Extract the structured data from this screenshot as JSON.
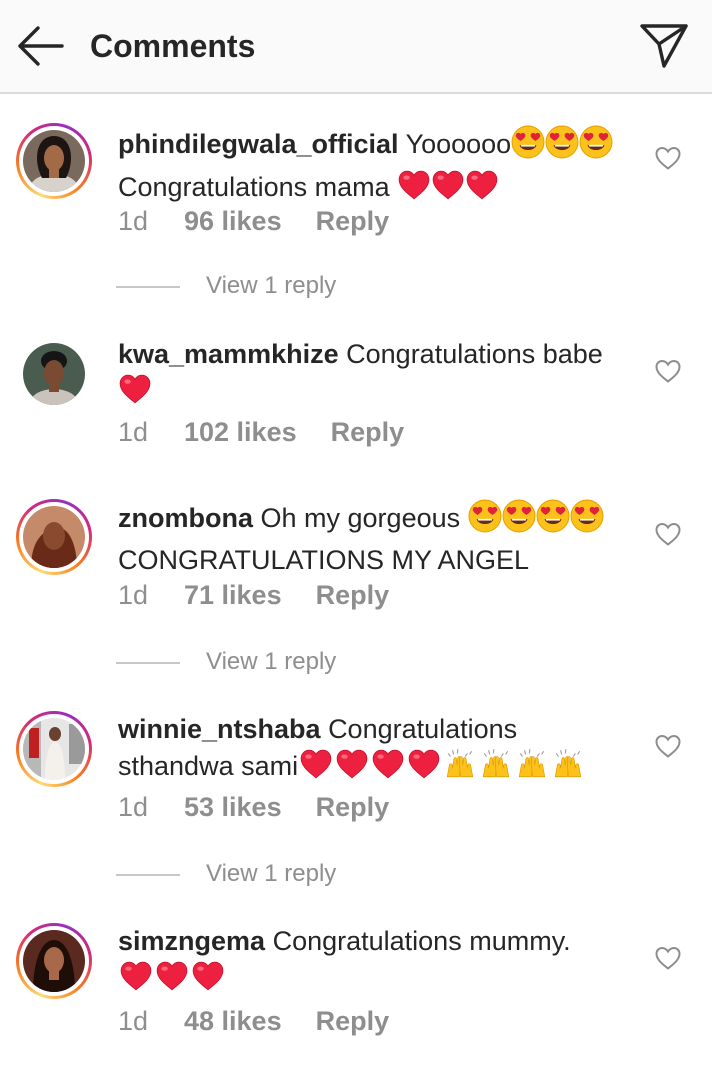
{
  "header": {
    "title": "Comments",
    "back_icon": "arrow-left-icon",
    "send_icon": "paper-plane-icon"
  },
  "colors": {
    "text": "#262626",
    "secondary": "#8e8e8e",
    "heart": "#ed2040",
    "story_ring": [
      "#feda75",
      "#fa7e1e",
      "#d62976",
      "#962fbf"
    ]
  },
  "comments": [
    {
      "username": "phindilegwala_official",
      "line1": "Yoooooo",
      "line1_emoji": [
        "heart-eyes",
        "heart-eyes",
        "heart-eyes"
      ],
      "line2": "Congratulations mama ",
      "line2_emoji": [
        "red-heart",
        "red-heart",
        "red-heart"
      ],
      "time": "1d",
      "likes": "96 likes",
      "reply": "Reply",
      "view_replies": "View 1 reply"
    },
    {
      "username": "kwa_mammkhize",
      "line1": "Congratulations babe",
      "line2_emoji": [
        "red-heart"
      ],
      "time": "1d",
      "likes": "102 likes",
      "reply": "Reply"
    },
    {
      "username": "znombona",
      "line1": "Oh my gorgeous ",
      "line1_emoji": [
        "heart-eyes",
        "heart-eyes",
        "heart-eyes",
        "heart-eyes"
      ],
      "line2": "CONGRATULATIONS MY ANGEL",
      "time": "1d",
      "likes": "71 likes",
      "reply": "Reply",
      "view_replies": "View 1 reply"
    },
    {
      "username": "winnie_ntshaba",
      "line1": "Congratulations",
      "line2": "sthandwa sami",
      "line2_emoji": [
        "red-heart",
        "red-heart",
        "red-heart",
        "red-heart",
        "raising-hands",
        "raising-hands",
        "raising-hands",
        "raising-hands"
      ],
      "time": "1d",
      "likes": "53 likes",
      "reply": "Reply",
      "view_replies": "View 1 reply"
    },
    {
      "username": "simzngema",
      "line1": "Congratulations mummy.",
      "line2_emoji": [
        "red-heart",
        "red-heart",
        "red-heart"
      ],
      "time": "1d",
      "likes": "48 likes",
      "reply": "Reply"
    }
  ]
}
